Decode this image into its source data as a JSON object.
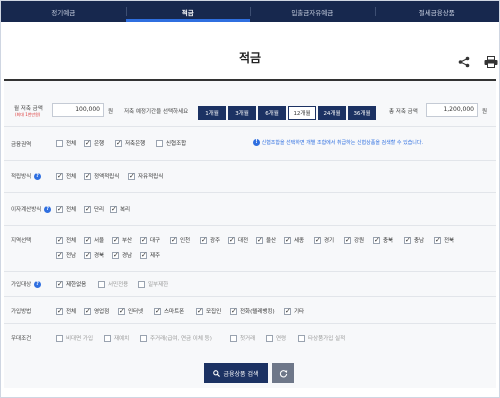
{
  "tabs": [
    "정기예금",
    "적금",
    "입출금자유예금",
    "절세금융상품"
  ],
  "page_title": "적금",
  "icons": {
    "share": "share-icon",
    "print": "print-icon",
    "search": "search-icon",
    "reset": "reset-icon",
    "info": "info-icon"
  },
  "monthly": {
    "label": "월 저축 금액",
    "sublabel": "(최대 1천만원)",
    "value": "100,000",
    "unit": "원"
  },
  "period": {
    "label": "저축 예정기간을 선택하세요",
    "options": [
      "1개월",
      "3개월",
      "6개월",
      "12개월",
      "24개월",
      "36개월"
    ],
    "selected": "12개월"
  },
  "total": {
    "label": "총 저축 금액",
    "value": "1,200,000",
    "unit": "원"
  },
  "bank": {
    "label": "금융권역",
    "options": [
      {
        "text": "전체",
        "checked": false
      },
      {
        "text": "은행",
        "checked": true
      },
      {
        "text": "저축은행",
        "checked": true
      },
      {
        "text": "신협조합",
        "checked": false
      }
    ],
    "notice": "신협조합을 선택하면 개별 조합에서 취급하는 신협상품을 검색할 수 있습니다."
  },
  "saving_type": {
    "label": "적립방식",
    "options": [
      {
        "text": "전체",
        "checked": true
      },
      {
        "text": "정액적립식",
        "checked": true
      },
      {
        "text": "자유적립식",
        "checked": true
      }
    ]
  },
  "interest": {
    "label": "이자계산방식",
    "options": [
      {
        "text": "전체",
        "checked": true
      },
      {
        "text": "단리",
        "checked": true
      },
      {
        "text": "복리",
        "checked": true
      }
    ]
  },
  "region": {
    "label": "지역선택",
    "options": [
      "전체",
      "서울",
      "부산",
      "대구",
      "인천",
      "광주",
      "대전",
      "울산",
      "세종",
      "경기",
      "강원",
      "충북",
      "충남",
      "전북",
      "전남",
      "경북",
      "경남",
      "제주"
    ]
  },
  "join_target": {
    "label": "가입대상",
    "options": [
      {
        "text": "제한없음",
        "checked": true
      },
      {
        "text": "서민전용",
        "checked": false
      },
      {
        "text": "일부제한",
        "checked": false
      }
    ]
  },
  "join_method": {
    "label": "가입방법",
    "options": [
      {
        "text": "전체",
        "checked": true
      },
      {
        "text": "영업점",
        "checked": true
      },
      {
        "text": "인터넷",
        "checked": true
      },
      {
        "text": "스마트폰",
        "checked": true
      },
      {
        "text": "모집인",
        "checked": true
      },
      {
        "text": "전화(텔레뱅킹)",
        "checked": true
      },
      {
        "text": "기타",
        "checked": true
      }
    ]
  },
  "preferential": {
    "label": "우대조건",
    "options": [
      "비대면 가입",
      "재예치",
      "주거래(급여, 연금 이체 등)",
      "첫거래",
      "연령",
      "타상품가입 실적"
    ]
  },
  "search_button": "금융상품 검색"
}
